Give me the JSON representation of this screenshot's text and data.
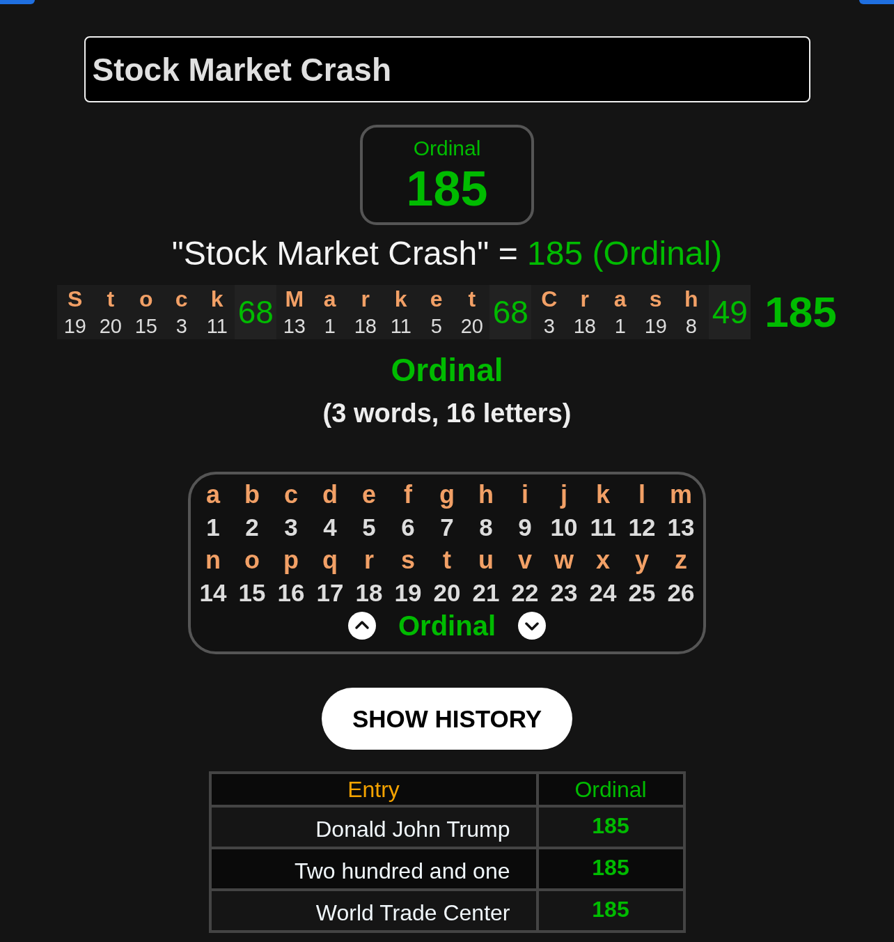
{
  "search": {
    "value": "Stock Market Crash"
  },
  "result_card": {
    "cipher": "Ordinal",
    "total": "185"
  },
  "equation": {
    "text": "\"Stock Market Crash\" =",
    "result": "185 (Ordinal)"
  },
  "breakdown": {
    "words": [
      {
        "letters": [
          {
            "letter": "S",
            "value": "19"
          },
          {
            "letter": "t",
            "value": "20"
          },
          {
            "letter": "o",
            "value": "15"
          },
          {
            "letter": "c",
            "value": "3"
          },
          {
            "letter": "k",
            "value": "11"
          }
        ],
        "total": "68"
      },
      {
        "letters": [
          {
            "letter": "M",
            "value": "13"
          },
          {
            "letter": "a",
            "value": "1"
          },
          {
            "letter": "r",
            "value": "18"
          },
          {
            "letter": "k",
            "value": "11"
          },
          {
            "letter": "e",
            "value": "5"
          },
          {
            "letter": "t",
            "value": "20"
          }
        ],
        "total": "68"
      },
      {
        "letters": [
          {
            "letter": "C",
            "value": "3"
          },
          {
            "letter": "r",
            "value": "18"
          },
          {
            "letter": "a",
            "value": "1"
          },
          {
            "letter": "s",
            "value": "19"
          },
          {
            "letter": "h",
            "value": "8"
          }
        ],
        "total": "49"
      }
    ],
    "grand_total": "185"
  },
  "cipher_name": "Ordinal",
  "counts": "(3 words, 16 letters)",
  "cipher_chart": {
    "rows": [
      [
        {
          "letter": "a",
          "value": "1"
        },
        {
          "letter": "b",
          "value": "2"
        },
        {
          "letter": "c",
          "value": "3"
        },
        {
          "letter": "d",
          "value": "4"
        },
        {
          "letter": "e",
          "value": "5"
        },
        {
          "letter": "f",
          "value": "6"
        },
        {
          "letter": "g",
          "value": "7"
        },
        {
          "letter": "h",
          "value": "8"
        },
        {
          "letter": "i",
          "value": "9"
        },
        {
          "letter": "j",
          "value": "10"
        },
        {
          "letter": "k",
          "value": "11"
        },
        {
          "letter": "l",
          "value": "12"
        },
        {
          "letter": "m",
          "value": "13"
        }
      ],
      [
        {
          "letter": "n",
          "value": "14"
        },
        {
          "letter": "o",
          "value": "15"
        },
        {
          "letter": "p",
          "value": "16"
        },
        {
          "letter": "q",
          "value": "17"
        },
        {
          "letter": "r",
          "value": "18"
        },
        {
          "letter": "s",
          "value": "19"
        },
        {
          "letter": "t",
          "value": "20"
        },
        {
          "letter": "u",
          "value": "21"
        },
        {
          "letter": "v",
          "value": "22"
        },
        {
          "letter": "w",
          "value": "23"
        },
        {
          "letter": "x",
          "value": "24"
        },
        {
          "letter": "y",
          "value": "25"
        },
        {
          "letter": "z",
          "value": "26"
        }
      ]
    ],
    "cipher": "Ordinal"
  },
  "history_button": "SHOW HISTORY",
  "table": {
    "columns": [
      "Entry",
      "Ordinal"
    ],
    "rows": [
      {
        "entry": "Donald John Trump",
        "value": "185"
      },
      {
        "entry": "Two hundred and one",
        "value": "185"
      },
      {
        "entry": "World Trade Center",
        "value": "185"
      }
    ]
  }
}
